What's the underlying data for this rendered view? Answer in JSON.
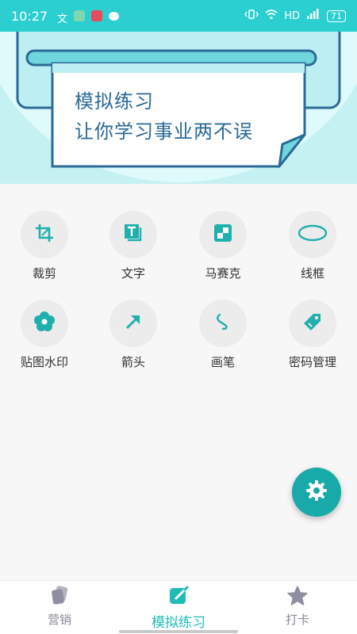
{
  "status_bar": {
    "time": "10:27",
    "network": "HD",
    "battery": "71"
  },
  "banner": {
    "line1": "模拟练习",
    "line2": "让你学习事业两不误"
  },
  "tools": [
    {
      "label": "裁剪",
      "icon": "crop-icon"
    },
    {
      "label": "文字",
      "icon": "text-icon"
    },
    {
      "label": "马赛克",
      "icon": "mosaic-icon"
    },
    {
      "label": "线框",
      "icon": "ellipse-frame-icon"
    },
    {
      "label": "贴图水印",
      "icon": "flower-sticker-icon"
    },
    {
      "label": "箭头",
      "icon": "arrow-icon"
    },
    {
      "label": "画笔",
      "icon": "brush-stroke-icon"
    },
    {
      "label": "密码管理",
      "icon": "tag-icon"
    }
  ],
  "bottom_nav": {
    "items": [
      {
        "label": "营销",
        "icon": "cards-icon"
      },
      {
        "label": "模拟练习",
        "icon": "edit-icon"
      },
      {
        "label": "打卡",
        "icon": "star-icon"
      }
    ]
  },
  "colors": {
    "accent": "#1fbcb8",
    "status_bar": "#2ccfcf",
    "fab": "#18aaa8",
    "banner_text": "#2b6a97"
  }
}
